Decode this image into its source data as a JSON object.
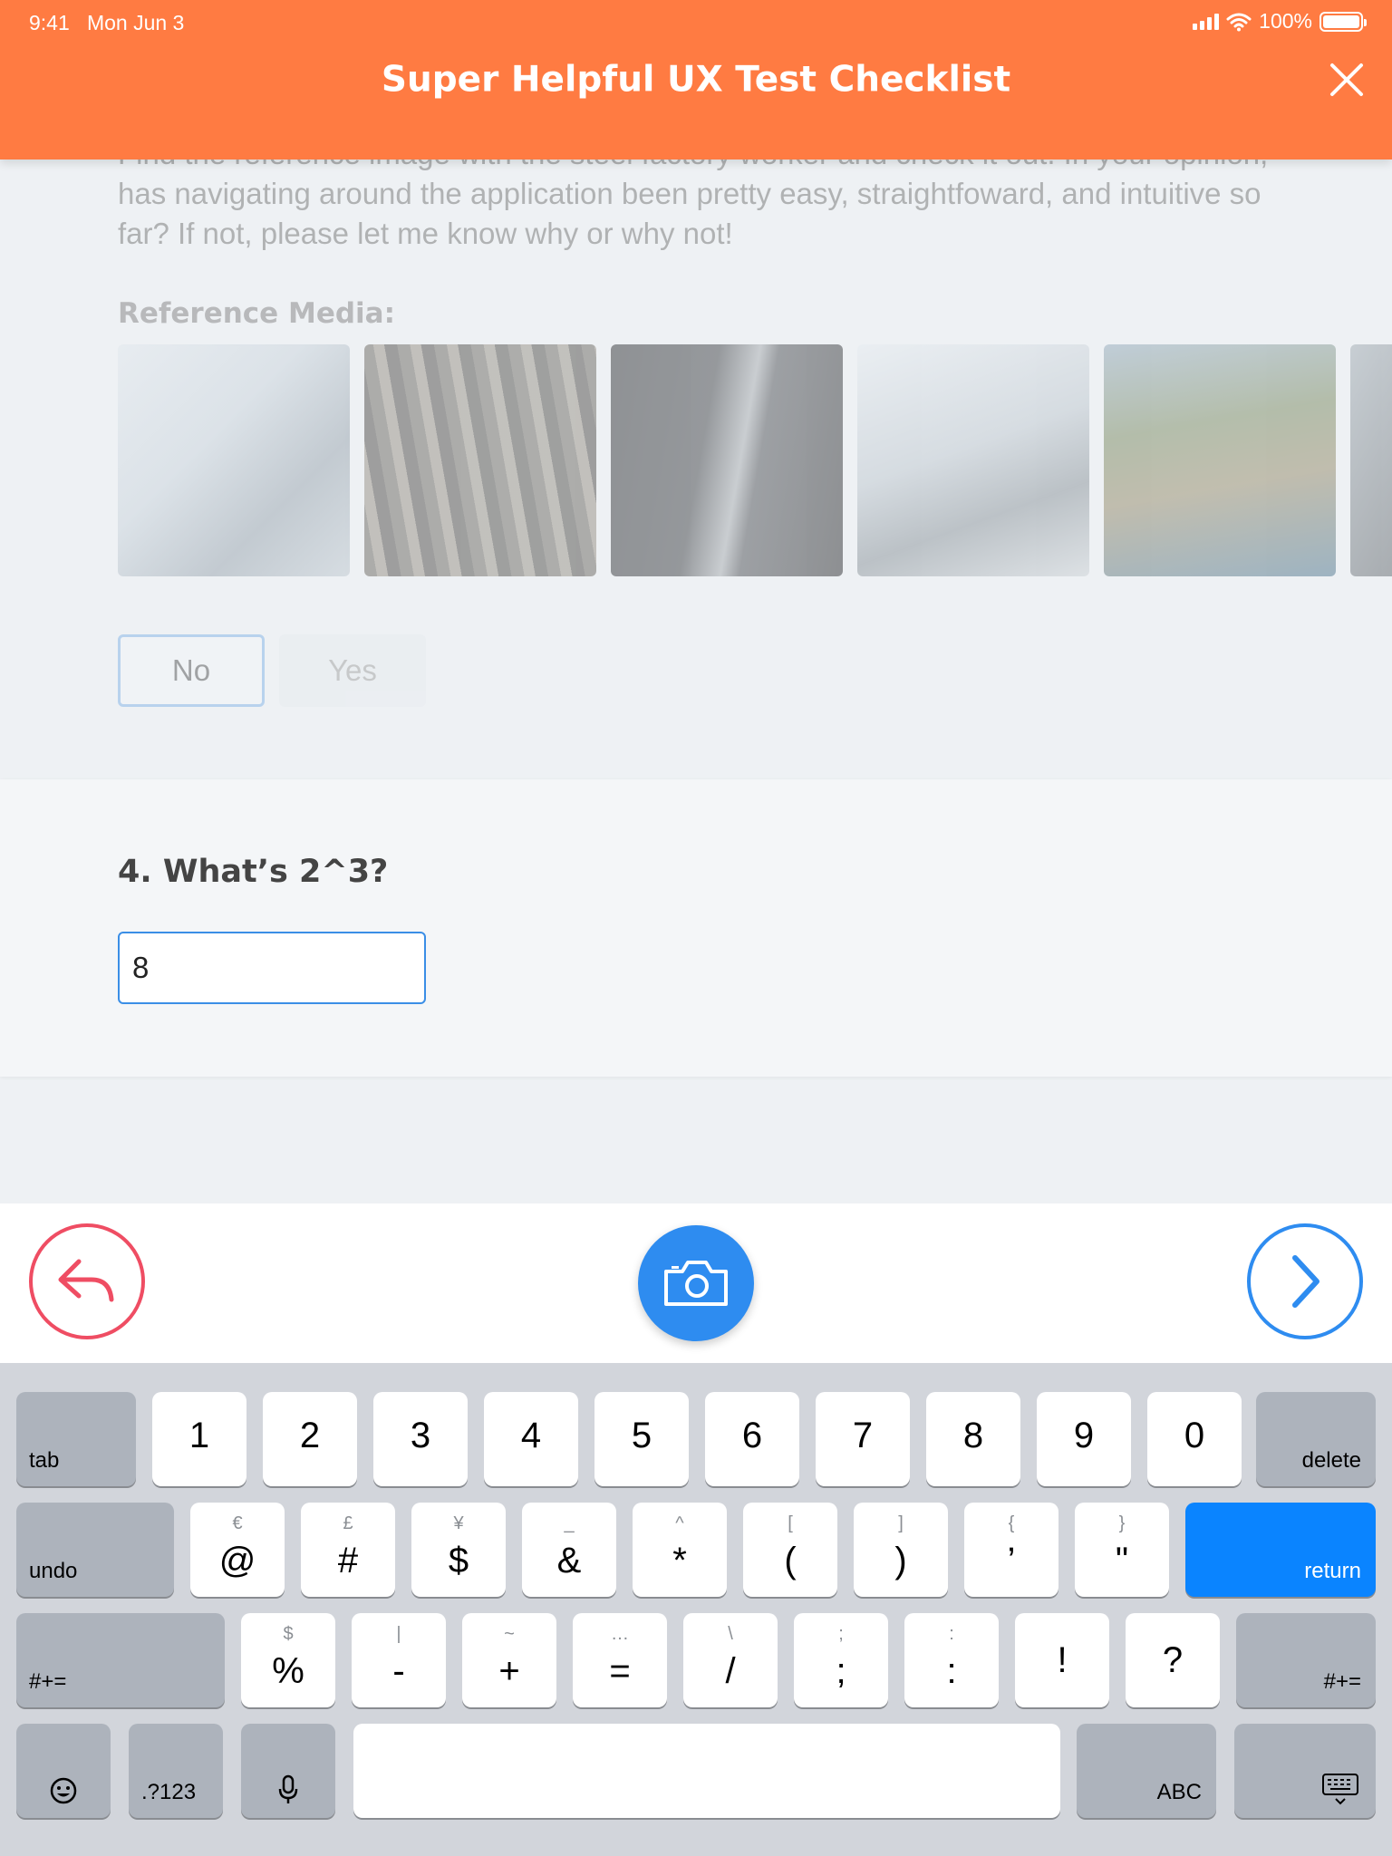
{
  "status_bar": {
    "time": "9:41",
    "date": "Mon Jun 3",
    "battery": "100%"
  },
  "header": {
    "title": "Super Helpful UX Test Checklist"
  },
  "previous_question": {
    "text": "Find the reference image with the steel factory worker and check it out. In your opinion, has navigating around the application been pretty easy, straightfoward, and intuitive so far? If not, please let me know why or why not!",
    "reference_label": "Reference Media:",
    "no_label": "No",
    "yes_label": "Yes"
  },
  "question": {
    "title": "4. What’s 2^3?",
    "answer_value": "8"
  },
  "keyboard": {
    "row1": {
      "tab": "tab",
      "delete": "delete",
      "keys": [
        "1",
        "2",
        "3",
        "4",
        "5",
        "6",
        "7",
        "8",
        "9",
        "0"
      ]
    },
    "row2": {
      "undo": "undo",
      "return": "return",
      "keys": [
        "@",
        "#",
        "$",
        "&",
        "*",
        "(",
        ")",
        "’",
        "\""
      ],
      "alts": [
        "€",
        "£",
        "¥",
        "_",
        "^",
        "[",
        "]",
        "{",
        "}"
      ]
    },
    "row3": {
      "left": "#+=",
      "right": "#+=",
      "keys": [
        "%",
        "-",
        "+",
        "=",
        "/",
        ";",
        ":",
        "!",
        "?"
      ],
      "alts": [
        "$",
        "|",
        "~",
        "…",
        "\\",
        ";",
        ":",
        "",
        ""
      ]
    },
    "row4": {
      "numbers": ".?123",
      "abc": "ABC"
    }
  },
  "colors": {
    "accent": "#ff7b42",
    "primary": "#2e8cf0",
    "danger": "#ef4d63"
  },
  "icons": [
    "close-icon",
    "signal-icon",
    "wifi-icon",
    "battery-icon",
    "reply-icon",
    "camera-icon",
    "chevron-right-icon",
    "emoji-icon",
    "microphone-icon",
    "keyboard-dismiss-icon"
  ]
}
